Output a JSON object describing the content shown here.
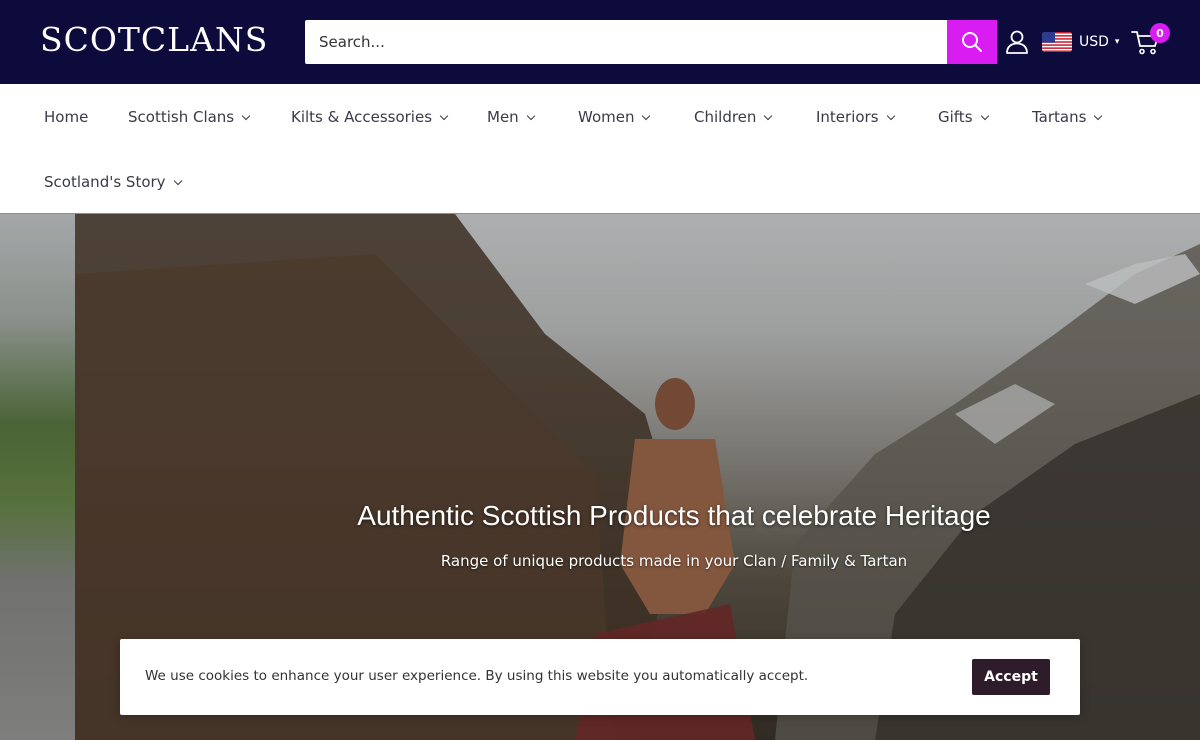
{
  "header": {
    "logo": "SCOTCLANS",
    "search_placeholder": "Search...",
    "currency": "USD",
    "cart_count": "0"
  },
  "nav": {
    "items": [
      {
        "label": "Home"
      },
      {
        "label": "Scottish Clans"
      },
      {
        "label": "Kilts & Accessories"
      },
      {
        "label": "Men"
      },
      {
        "label": "Women"
      },
      {
        "label": "Children"
      },
      {
        "label": "Interiors"
      },
      {
        "label": "Gifts"
      },
      {
        "label": "Tartans"
      },
      {
        "label": "Scotland's Story"
      }
    ]
  },
  "hero": {
    "title": "Authentic Scottish Products that celebrate Heritage",
    "subtitle": "Range of unique products made in your Clan / Family & Tartan"
  },
  "cookie": {
    "text": "We use cookies to enhance your user experience. By using this website you automatically accept.",
    "accept_label": "Accept"
  },
  "colors": {
    "header_bg": "#0d0b3b",
    "accent": "#d91cf2",
    "cookie_button": "#2e1c2a"
  }
}
